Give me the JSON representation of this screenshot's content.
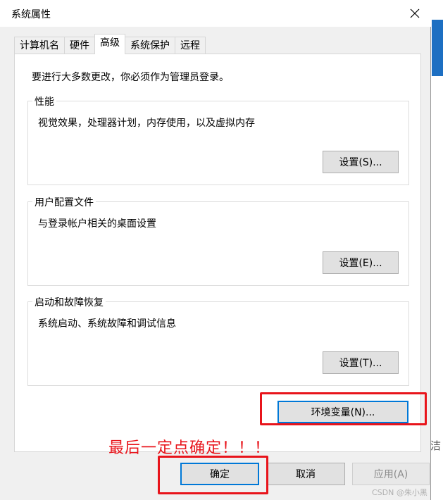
{
  "window": {
    "title": "系统属性"
  },
  "tabs": [
    {
      "label": "计算机名"
    },
    {
      "label": "硬件"
    },
    {
      "label": "高级"
    },
    {
      "label": "系统保护"
    },
    {
      "label": "远程"
    }
  ],
  "intro": "要进行大多数更改，你必须作为管理员登录。",
  "performance": {
    "label": "性能",
    "desc": "视觉效果，处理器计划，内存使用，以及虚拟内存",
    "button": "设置(S)..."
  },
  "profiles": {
    "label": "用户配置文件",
    "desc": "与登录帐户相关的桌面设置",
    "button": "设置(E)..."
  },
  "startup": {
    "label": "启动和故障恢复",
    "desc": "系统启动、系统故障和调试信息",
    "button": "设置(T)..."
  },
  "env_button": "环境变量(N)...",
  "annotation": "最后一定点确定！！！",
  "footer": {
    "ok": "确定",
    "cancel": "取消",
    "apply": "应用(A)"
  },
  "watermark": "CSDN @朱小黑",
  "colors": {
    "annotation": "#e8141b",
    "focus": "#0078d7"
  }
}
